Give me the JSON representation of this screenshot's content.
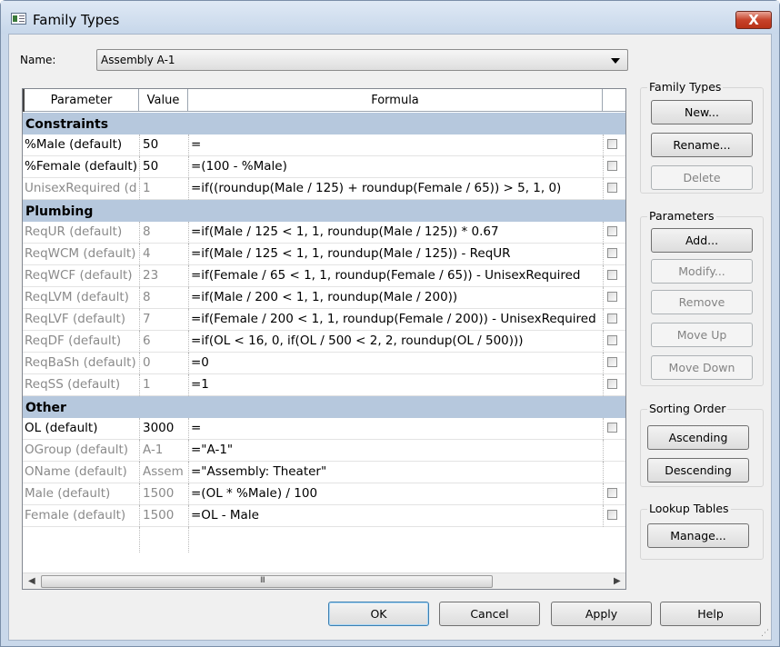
{
  "window": {
    "title": "Family Types",
    "close_glyph": "X"
  },
  "name_field": {
    "label": "Name:",
    "value": "Assembly A-1"
  },
  "table": {
    "headers": [
      "Parameter",
      "Value",
      "Formula"
    ],
    "groups": [
      {
        "name": "Constraints",
        "rows": [
          {
            "param": "%Male (default)",
            "value": "50",
            "formula": "=",
            "gray": false,
            "checkbox": true
          },
          {
            "param": "%Female (default)",
            "value": "50",
            "formula": "=(100 - %Male)",
            "gray": false,
            "checkbox": true
          },
          {
            "param": "UnisexRequired (d",
            "value": "1",
            "formula": "=if((roundup(Male / 125) + roundup(Female / 65)) > 5, 1, 0)",
            "gray": true,
            "checkbox": true
          }
        ]
      },
      {
        "name": "Plumbing",
        "rows": [
          {
            "param": "ReqUR (default)",
            "value": "8",
            "formula": "=if(Male / 125 < 1, 1, roundup(Male / 125)) * 0.67",
            "gray": true,
            "checkbox": true
          },
          {
            "param": "ReqWCM (default)",
            "value": "4",
            "formula": "=if(Male / 125 < 1, 1, roundup(Male / 125)) - ReqUR",
            "gray": true,
            "checkbox": true
          },
          {
            "param": "ReqWCF (default)",
            "value": "23",
            "formula": "=if(Female / 65 < 1, 1, roundup(Female / 65)) - UnisexRequired",
            "gray": true,
            "checkbox": true
          },
          {
            "param": "ReqLVM (default)",
            "value": "8",
            "formula": "=if(Male / 200 < 1, 1, roundup(Male / 200))",
            "gray": true,
            "checkbox": true
          },
          {
            "param": "ReqLVF (default)",
            "value": "7",
            "formula": "=if(Female / 200 < 1, 1, roundup(Female / 200)) - UnisexRequired",
            "gray": true,
            "checkbox": true
          },
          {
            "param": "ReqDF (default)",
            "value": "6",
            "formula": "=if(OL < 16, 0, if(OL / 500 < 2, 2, roundup(OL / 500)))",
            "gray": true,
            "checkbox": true
          },
          {
            "param": "ReqBaSh (default)",
            "value": "0",
            "formula": "=0",
            "gray": true,
            "checkbox": true
          },
          {
            "param": "ReqSS (default)",
            "value": "1",
            "formula": "=1",
            "gray": true,
            "checkbox": true
          }
        ]
      },
      {
        "name": "Other",
        "rows": [
          {
            "param": "OL (default)",
            "value": "3000",
            "formula": "=",
            "gray": false,
            "checkbox": true
          },
          {
            "param": "OGroup (default)",
            "value": "A-1",
            "formula": "=\"A-1\"",
            "gray": true,
            "checkbox": false
          },
          {
            "param": "OName (default)",
            "value": "Assem",
            "formula": "=\"Assembly: Theater\"",
            "gray": true,
            "checkbox": false
          },
          {
            "param": "Male (default)",
            "value": "1500",
            "formula": "=(OL * %Male) / 100",
            "gray": true,
            "checkbox": true
          },
          {
            "param": "Female (default)",
            "value": "1500",
            "formula": "=OL - Male",
            "gray": true,
            "checkbox": true
          }
        ]
      }
    ],
    "scroll": {
      "left_arrow": "◀",
      "right_arrow": "▶",
      "grip": "III"
    }
  },
  "family_types_group": {
    "label": "Family Types",
    "new": "New...",
    "rename": "Rename...",
    "delete": "Delete"
  },
  "parameters_group": {
    "label": "Parameters",
    "add": "Add...",
    "modify": "Modify...",
    "remove": "Remove",
    "move_up": "Move Up",
    "move_down": "Move Down"
  },
  "sorting_group": {
    "label": "Sorting Order",
    "ascending": "Ascending",
    "descending": "Descending"
  },
  "lookup_group": {
    "label": "Lookup Tables",
    "manage": "Manage..."
  },
  "footer": {
    "ok": "OK",
    "cancel": "Cancel",
    "apply": "Apply",
    "help": "Help"
  }
}
